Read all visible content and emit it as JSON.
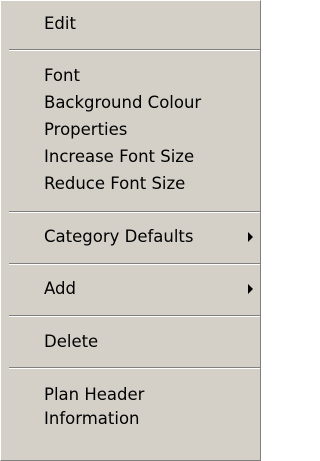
{
  "menu": {
    "items": [
      {
        "label": "Edit"
      },
      {
        "label": "Font"
      },
      {
        "label": "Background Colour"
      },
      {
        "label": "Properties"
      },
      {
        "label": "Increase Font Size"
      },
      {
        "label": "Reduce Font Size"
      },
      {
        "label": "Category Defaults",
        "submenu": true
      },
      {
        "label": "Add",
        "submenu": true
      },
      {
        "label": "Delete"
      },
      {
        "label": "Plan Header"
      },
      {
        "label": "Information"
      }
    ],
    "submenu_icon": "triangle-right-icon",
    "colors": {
      "background": "#d4d0c8",
      "text": "#000000",
      "separator_dark": "#808080",
      "separator_light": "#ffffff"
    }
  }
}
